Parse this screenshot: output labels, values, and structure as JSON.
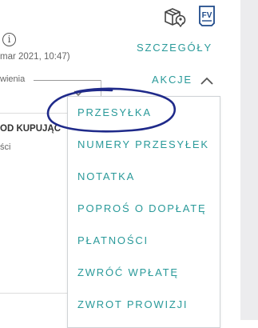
{
  "toolbar": {
    "package_icon": "package-location-icon",
    "invoice_icon": "invoice-fv-icon",
    "invoice_badge": "FV"
  },
  "order": {
    "info_icon_glyph": "i",
    "date_text": "mar 2021, 10:47)",
    "details_label": "SZCZEGÓŁY",
    "actions_label": "AKCJE",
    "field_label": "wienia",
    "section_heading": "OD KUPUJĄC",
    "section_sub": "ści"
  },
  "actions_menu": {
    "items": [
      {
        "label": "PRZESYŁKA"
      },
      {
        "label": "NUMERY PRZESYŁEK"
      },
      {
        "label": "NOTATKA"
      },
      {
        "label": "POPROŚ O DOPŁATĘ"
      },
      {
        "label": "PŁATNOŚCI"
      },
      {
        "label": "ZWRÓĆ WPŁATĘ"
      },
      {
        "label": "ZWROT PROWIZJI"
      }
    ]
  },
  "colors": {
    "accent": "#2a9a9a",
    "annotation": "#1f2a8a",
    "sidebar": "#ececee"
  }
}
